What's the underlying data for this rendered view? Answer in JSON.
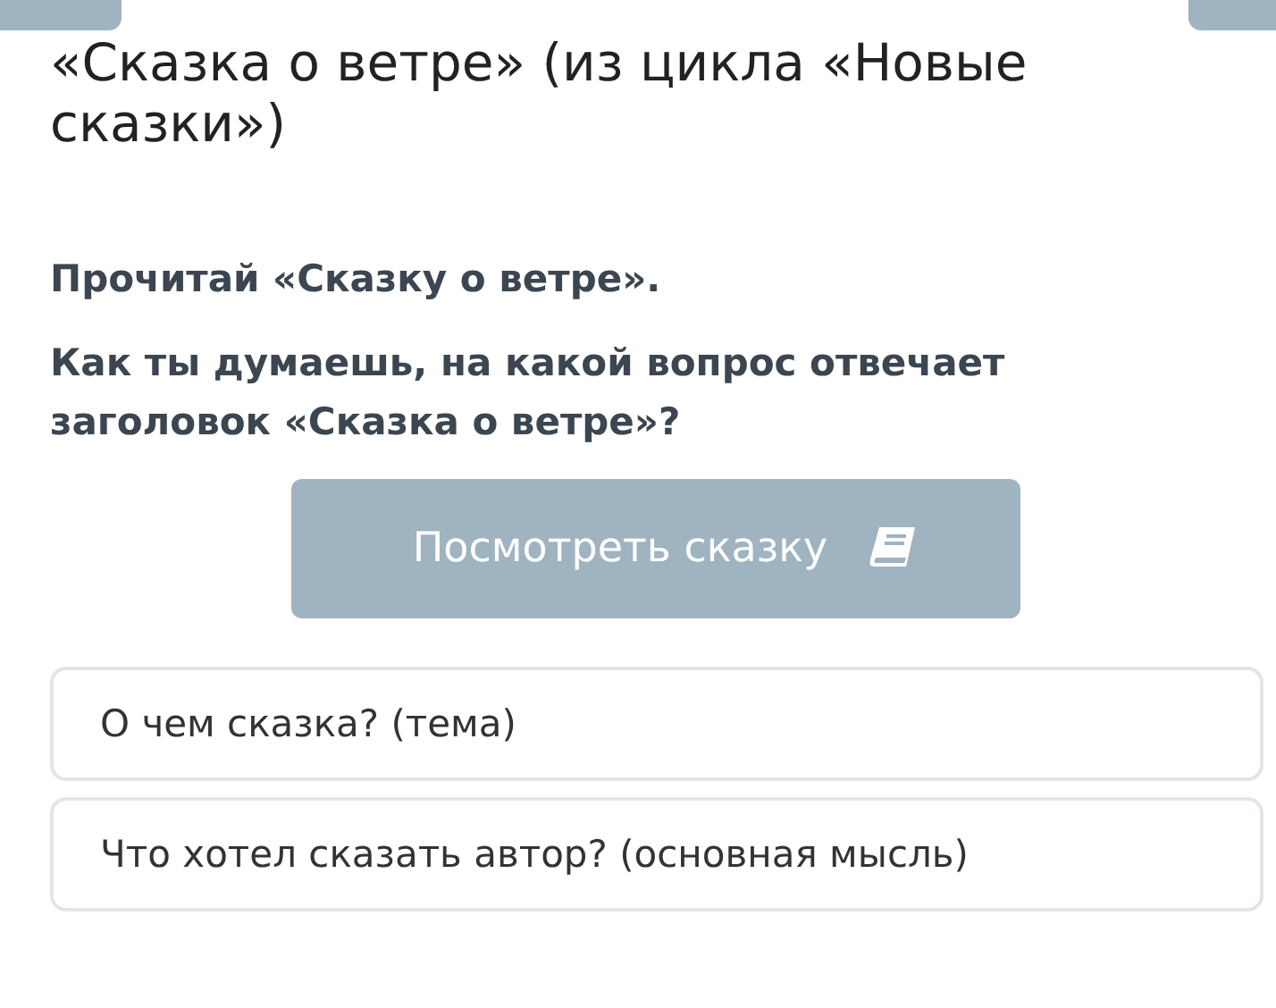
{
  "title": "«Сказка о ветре» (из цикла «Новые сказки»)",
  "instructions": [
    "Прочитай «Сказку о ветре».",
    "Как ты думаешь, на какой вопрос отвечает заголовок «Сказка о ветре»?"
  ],
  "story_button": {
    "label": "Посмотреть сказку"
  },
  "options": [
    {
      "label": "О чем сказка? (тема)"
    },
    {
      "label": "Что хотел сказать автор? (основная мысль)"
    }
  ]
}
